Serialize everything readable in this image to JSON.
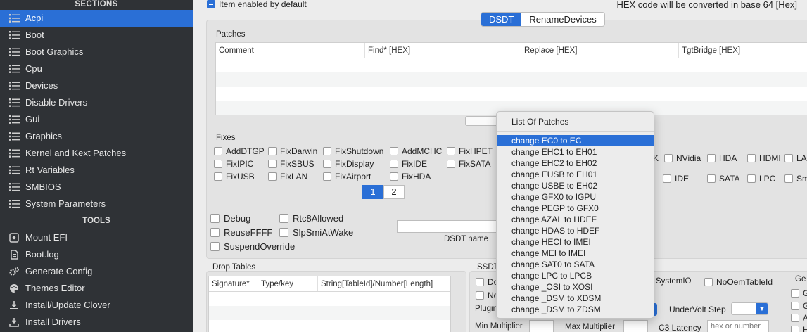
{
  "sidebar": {
    "sections_title": "SECTIONS",
    "sections": [
      {
        "label": "Acpi",
        "active": true
      },
      {
        "label": "Boot"
      },
      {
        "label": "Boot Graphics"
      },
      {
        "label": "Cpu"
      },
      {
        "label": "Devices"
      },
      {
        "label": "Disable Drivers"
      },
      {
        "label": "Gui"
      },
      {
        "label": "Graphics"
      },
      {
        "label": "Kernel and Kext Patches"
      },
      {
        "label": "Rt Variables"
      },
      {
        "label": "SMBIOS"
      },
      {
        "label": "System Parameters"
      }
    ],
    "tools_title": "TOOLS",
    "tools": [
      {
        "label": "Mount EFI",
        "icon": "disk-icon"
      },
      {
        "label": "Boot.log",
        "icon": "document-icon"
      },
      {
        "label": "Generate Config",
        "icon": "gear-icon"
      },
      {
        "label": "Themes Editor",
        "icon": "palette-icon"
      },
      {
        "label": "Install/Update Clover",
        "icon": "install-icon"
      },
      {
        "label": "Install Drivers",
        "icon": "download-icon"
      }
    ]
  },
  "top": {
    "item_enabled": "Item enabled by default",
    "hex_note": "HEX code will be converted in base 64 [Hex]"
  },
  "tabs": {
    "dsdt": "DSDT",
    "rename": "RenameDevices"
  },
  "patches": {
    "title": "Patches",
    "columns": [
      "Comment",
      "Find* [HEX]",
      "Replace [HEX]",
      "TgtBridge [HEX]"
    ]
  },
  "fixes": {
    "title": "Fixes",
    "col1": [
      "AddDTGP",
      "FixIPIC",
      "FixUSB"
    ],
    "col2": [
      "FixDarwin",
      "FixSBUS",
      "FixLAN"
    ],
    "col3": [
      "FixShutdown",
      "FixDisplay",
      "FixAirport"
    ],
    "col4": [
      "AddMCHC",
      "FixIDE",
      "FixHDA"
    ],
    "col5": [
      "FixHPET",
      "FixSATA"
    ],
    "right_row1": [
      "K",
      "NVidia",
      "HDA",
      "HDMI",
      "LA"
    ],
    "right_row2": [
      "IDE",
      "SATA",
      "LPC",
      "Sm"
    ],
    "pages": [
      "1",
      "2"
    ]
  },
  "options": {
    "debug": "Debug",
    "rtc8": "Rtc8Allowed",
    "reuse": "ReuseFFFF",
    "slpsmi": "SlpSmiAtWake",
    "suspend": "SuspendOverride",
    "dsdt_name": "DSDT name"
  },
  "drop_tables": {
    "title": "Drop Tables",
    "columns": [
      "Signature*",
      "Type/key",
      "String[TableId]/Number[Length]"
    ]
  },
  "ssdt": {
    "title": "SSDT",
    "do": "Do",
    "no": "No",
    "plugin": "Plugin",
    "systemio": "SystemIO",
    "nooem": "NoOemTableId",
    "gen": "Ge",
    "gen_items": [
      "G",
      "G",
      "A",
      "H"
    ],
    "undervolt": "UnderVolt Step",
    "min_mult": "Min Multiplier",
    "max_mult": "Max Multiplier",
    "c3": "C3 Latency",
    "c3_placeholder": "hex or number"
  },
  "popup": {
    "title": "List Of Patches",
    "items": [
      "change EC0 to EC",
      "change EHC1 to EH01",
      "change EHC2 to EH02",
      "change EUSB to EH01",
      "change USBE to EH02",
      "change GFX0 to IGPU",
      "change PEGP to GFX0",
      "change AZAL to HDEF",
      "change HDAS to HDEF",
      "change HECI to IMEI",
      "change MEI to IMEI",
      "change SAT0 to SATA",
      "change LPC to LPCB",
      "change _OSI to XOSI",
      "change _DSM to XDSM",
      "change _DSM to ZDSM"
    ]
  }
}
